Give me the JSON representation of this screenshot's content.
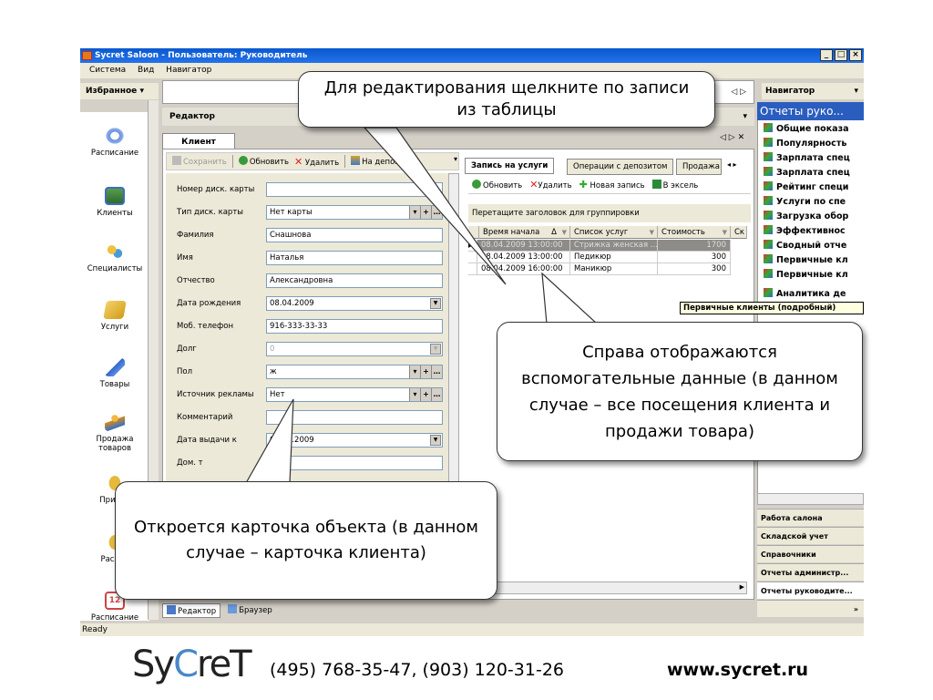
{
  "window": {
    "title": "Sycret Saloon - Пользователь: Руководитель",
    "min": "_",
    "max": "□",
    "close": "×"
  },
  "menu": [
    "Система",
    "Вид",
    "Навигатор"
  ],
  "left_panel": {
    "header": "Избранное",
    "items": [
      "Расписание",
      "Клиенты",
      "Специалисты",
      "Услуги",
      "Товары",
      "Продажа товаров",
      "Приход",
      "Расход",
      "Расписание"
    ]
  },
  "editor": {
    "header": "Редактор",
    "tab": "Клиент",
    "toolbar": {
      "save": "Сохранить",
      "refresh": "Обновить",
      "delete": "Удалить",
      "deposit": "На депозит"
    },
    "fields": [
      {
        "label": "Номер диск. карты",
        "value": ""
      },
      {
        "label": "Тип диск. карты",
        "value": "Нет карты"
      },
      {
        "label": "Фамилия",
        "value": "Снашнова"
      },
      {
        "label": "Имя",
        "value": "Наталья"
      },
      {
        "label": "Отчество",
        "value": "Александровна"
      },
      {
        "label": "Дата рождения",
        "value": "08.04.2009"
      },
      {
        "label": "Моб. телефон",
        "value": "916-333-33-33"
      },
      {
        "label": "Долг",
        "value": "0"
      },
      {
        "label": "Пол",
        "value": "ж"
      },
      {
        "label": "Источник рекламы",
        "value": "Нет"
      },
      {
        "label": "Комментарий",
        "value": ""
      },
      {
        "label": "Дата выдачи к",
        "value": "08.04.2009"
      },
      {
        "label": "Дом. т",
        "value": ""
      }
    ]
  },
  "grid": {
    "tabs": [
      "Запись на услуги",
      "Операции с депозитом",
      "Продажа"
    ],
    "toolbar": {
      "refresh": "Обновить",
      "delete": "Удалить",
      "new": "Новая запись",
      "excel": "В эксель"
    },
    "group_hint": "Перетащите заголовок для группировки",
    "columns": [
      "Время начала",
      "Список услуг",
      "Стоимость",
      "Ск"
    ],
    "rows": [
      [
        "08.04.2009 13:00:00",
        "Стрижка женская ...",
        "1700"
      ],
      [
        "08.04.2009 13:00:00",
        "Педикюр",
        "300"
      ],
      [
        "08.04.2009 16:00:00",
        "Маникюр",
        "300"
      ]
    ]
  },
  "bottom_tabs": [
    "Редактор",
    "Браузер"
  ],
  "navigator": {
    "header": "Навигатор",
    "title": "Отчеты руко...",
    "items": [
      "Общие показа",
      "Популярность",
      "Зарплата спец",
      "Зарплата спец",
      "Рейтинг специ",
      "Услуги по спе",
      "Загрузка обор",
      "Эффективнос",
      "Сводный отче",
      "Первичные кл",
      "Первичные кл",
      "Аналитика де"
    ],
    "tooltip": "Первичные клиенты (подробный)",
    "groups": [
      "Работа салона",
      "Складской учет",
      "Справочники",
      "Отчеты администр...",
      "Отчеты руководите..."
    ],
    "more": "»"
  },
  "status": "Ready",
  "callouts": {
    "top": "Для редактирования щелкните по записи из таблицы",
    "right": "Справа отображаются вспомогательные данные (в данном случае – все посещения клиента и продажи товара)",
    "left": "Откроется карточка объекта (в данном случае – карточка клиента)"
  },
  "footer": {
    "logo_a": "Sy",
    "logo_b": "C",
    "logo_c": "reT",
    "phones": "(495) 768-35-47, (903) 120-31-26",
    "website": "www.sycret.ru"
  }
}
